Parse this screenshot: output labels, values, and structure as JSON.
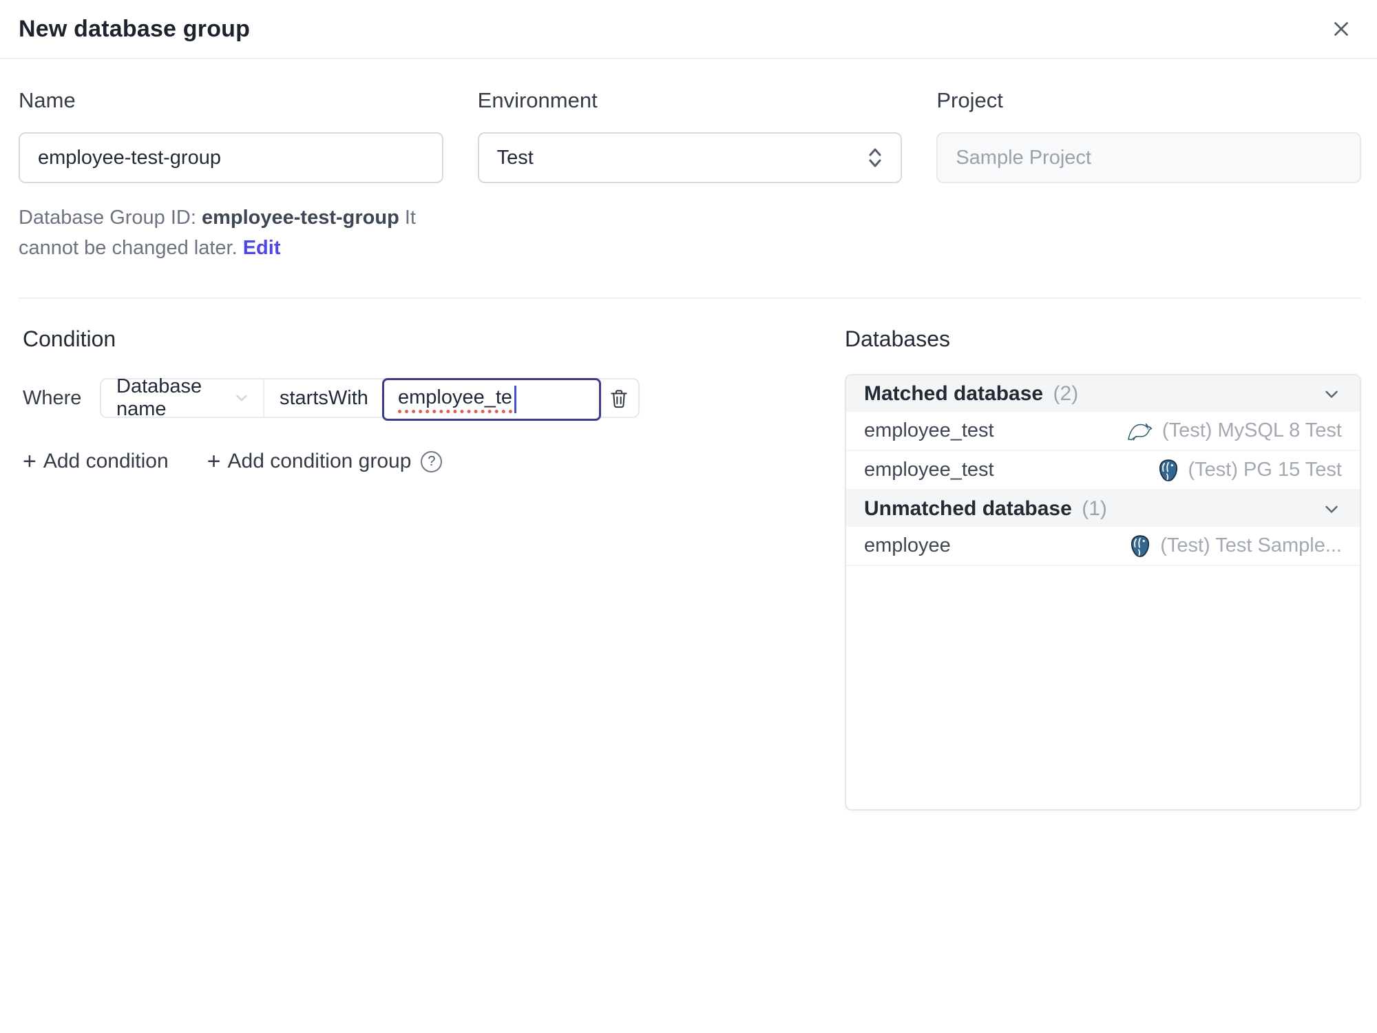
{
  "dialog": {
    "title": "New database group"
  },
  "form": {
    "name": {
      "label": "Name",
      "value": "employee-test-group"
    },
    "environment": {
      "label": "Environment",
      "value": "Test"
    },
    "project": {
      "label": "Project",
      "value": "Sample Project"
    },
    "id_helper": {
      "prefix": "Database Group ID: ",
      "id": "employee-test-group",
      "note": " It cannot be changed later. ",
      "edit_label": "Edit"
    }
  },
  "condition": {
    "heading": "Condition",
    "where_label": "Where",
    "factor": "Database name",
    "operator": "startsWith",
    "value": "employee_te",
    "add_condition_label": "Add condition",
    "add_condition_group_label": "Add condition group",
    "help_glyph": "?"
  },
  "databases": {
    "heading": "Databases",
    "matched": {
      "label": "Matched database",
      "count_display": "(2)",
      "rows": [
        {
          "name": "employee_test",
          "engine": "mysql",
          "instance": "(Test) MySQL 8 Test"
        },
        {
          "name": "employee_test",
          "engine": "postgres",
          "instance": "(Test) PG 15 Test"
        }
      ]
    },
    "unmatched": {
      "label": "Unmatched database",
      "count_display": "(1)",
      "rows": [
        {
          "name": "employee",
          "engine": "postgres",
          "instance": "(Test) Test Sample..."
        }
      ]
    }
  },
  "colors": {
    "accent": "#4f46e5",
    "focus_border": "#3b3a8e",
    "spell_error": "#e25c55",
    "header_bg": "#f4f5f6",
    "border": "#e5e7eb"
  }
}
